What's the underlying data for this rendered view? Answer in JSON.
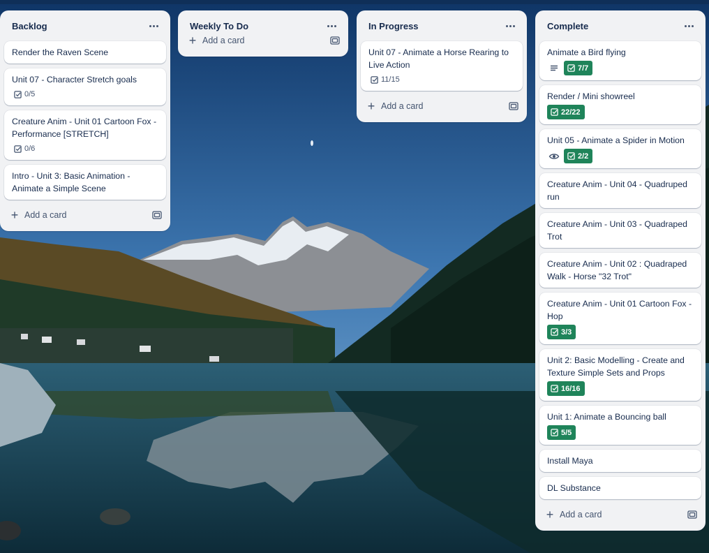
{
  "lists": [
    {
      "title": "Backlog",
      "cards": [
        {
          "title": "Render the Raven Scene"
        },
        {
          "title": "Unit 07 - Character Stretch goals",
          "checklist": "0/5"
        },
        {
          "title": "Creature Anim - Unit 01 Cartoon Fox - Performance [STRETCH]",
          "checklist": "0/6"
        },
        {
          "title": "Intro - Unit 3: Basic Animation - Animate a Simple Scene"
        }
      ],
      "add_label": "Add a card"
    },
    {
      "title": "Weekly To Do",
      "cards": [],
      "add_label": "Add a card"
    },
    {
      "title": "In Progress",
      "cards": [
        {
          "title": "Unit 07 - Animate a Horse Rearing to Live Action",
          "checklist": "11/15"
        }
      ],
      "add_label": "Add a card"
    },
    {
      "title": "Complete",
      "cards": [
        {
          "title": "Animate a Bird flying",
          "checklist_done": "7/7",
          "icon": "description-icon"
        },
        {
          "title": "Render / Mini showreel",
          "checklist_done": "22/22"
        },
        {
          "title": "Unit 05 - Animate a Spider in Motion",
          "checklist_done": "2/2",
          "icon": "eye-icon"
        },
        {
          "title": "Creature Anim - Unit 04 - Quadruped run"
        },
        {
          "title": "Creature Anim - Unit 03 - Quadraped Trot"
        },
        {
          "title": "Creature Anim - Unit 02 : Quadraped Walk - Horse \"32 Trot\""
        },
        {
          "title": "Creature Anim - Unit 01 Cartoon Fox - Hop",
          "checklist_done": "3/3"
        },
        {
          "title": "Unit 2: Basic Modelling - Create and Texture Simple Sets and Props",
          "checklist_done": "16/16"
        },
        {
          "title": "Unit 1: Animate a Bouncing ball",
          "checklist_done": "5/5"
        },
        {
          "title": "Install Maya"
        },
        {
          "title": "DL Substance"
        }
      ],
      "add_label": "Add a card"
    }
  ],
  "colors": {
    "list_bg": "#f1f2f4",
    "done_badge": "#1f845a",
    "text": "#172b4d"
  }
}
